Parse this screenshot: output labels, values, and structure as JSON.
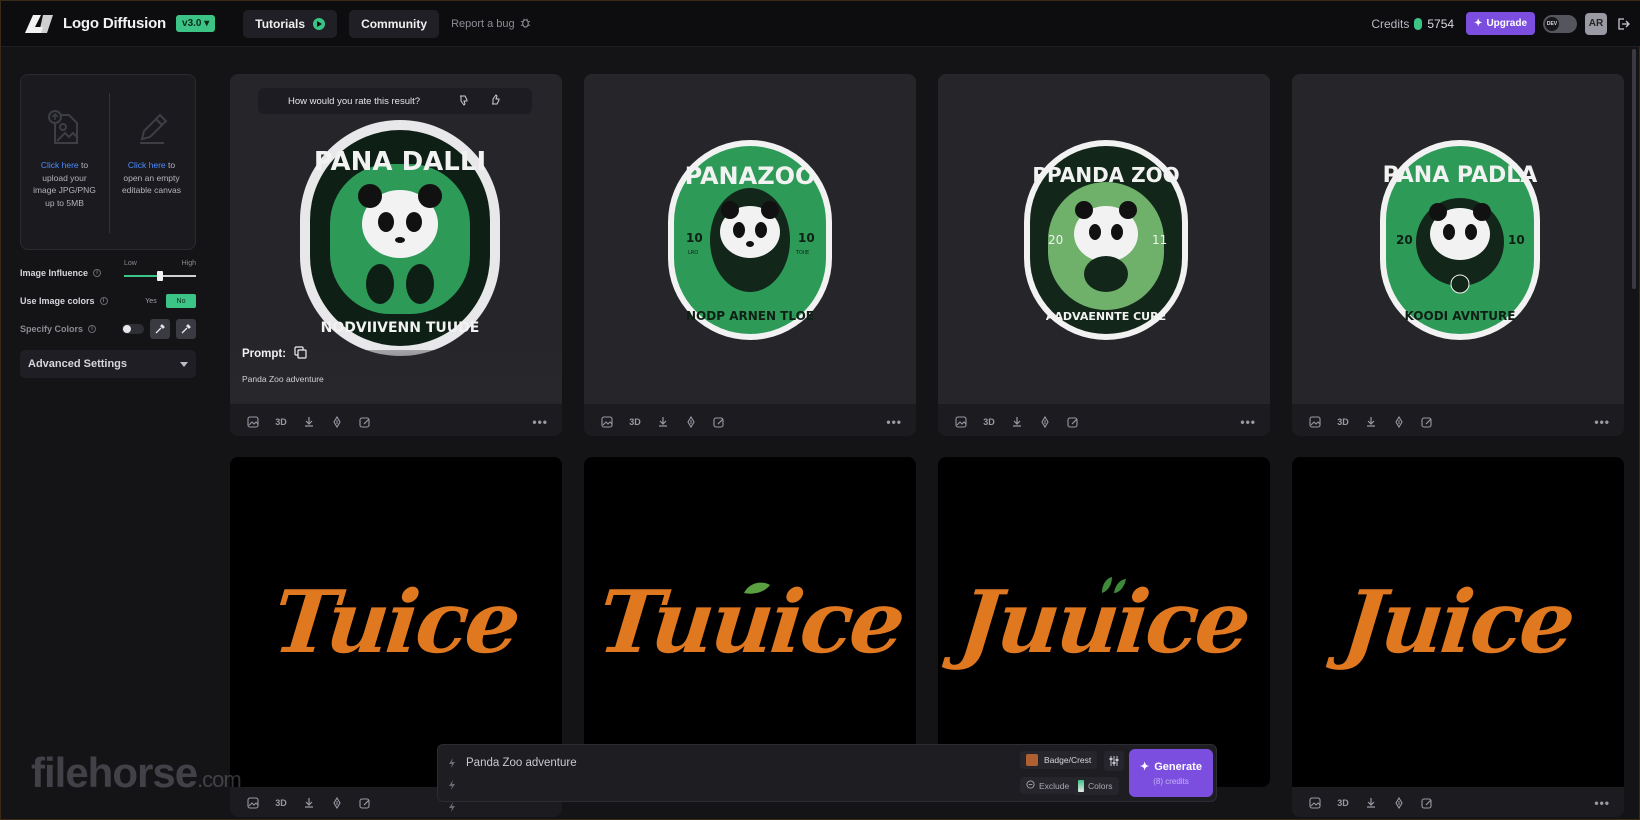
{
  "header": {
    "brand_name": "Logo Diffusion",
    "version": "v3.0 ▾",
    "tutorials_label": "Tutorials",
    "community_label": "Community",
    "report_bug_label": "Report a bug",
    "credits_label": "Credits",
    "credits_value": "5754",
    "upgrade_label": "Upgrade",
    "dev_label": "DEV",
    "avatar_initials": "AR"
  },
  "sidebar": {
    "upload": {
      "link": "Click here",
      "line1": " to",
      "line2": "upload your",
      "line3": "image JPG/PNG",
      "line4": "up to 5MB"
    },
    "canvas": {
      "link": "Click here",
      "line1": " to",
      "line2": "open an empty",
      "line3": "editable canvas"
    },
    "image_influence_label": "Image Influence",
    "influence_low": "Low",
    "influence_high": "High",
    "influence_level": 0.5,
    "use_image_colors_label": "Use Image colors",
    "yes_label": "Yes",
    "no_label": "No",
    "specify_colors_label": "Specify Colors",
    "advanced_label": "Advanced Settings"
  },
  "cards": {
    "rate_question": "How would you rate this result?",
    "prompt_label": "Prompt:",
    "prompt_text": "Panda Zoo adventure",
    "action_3d": "3D",
    "badges": [
      {
        "top": "PANA DALLI",
        "bottom": "NODVIIVENN TUUDE"
      },
      {
        "top": "PANAZOO",
        "bottom": "NODP ARNEN TLOE",
        "left": "10",
        "right": "10",
        "left_sub": "LRO",
        "right_sub": "TOIIE"
      },
      {
        "top": "PPANDA ZOO",
        "bottom": "AADVAENNTE CURE",
        "left": "20",
        "right": "11"
      },
      {
        "top": "PANA PADLA",
        "bottom": "KOODI AVNTURE",
        "left": "20",
        "right": "10"
      }
    ],
    "juice": [
      "Tuice",
      "Tuuice",
      "Juuice",
      "Juice"
    ]
  },
  "prompt_bar": {
    "text": "Panda Zoo adventure",
    "style_label": "Badge/Crest",
    "exclude_label": "Exclude",
    "colors_label": "Colors",
    "generate_label": "Generate",
    "generate_cost": "(8) credits"
  },
  "watermark": {
    "main": "filehorse",
    "suffix": ".com"
  },
  "colors": {
    "accent_green": "#3bc486",
    "accent_purple": "#7b4ee0",
    "juice_orange": "#e07820",
    "badge_green": "#2e9a58"
  }
}
